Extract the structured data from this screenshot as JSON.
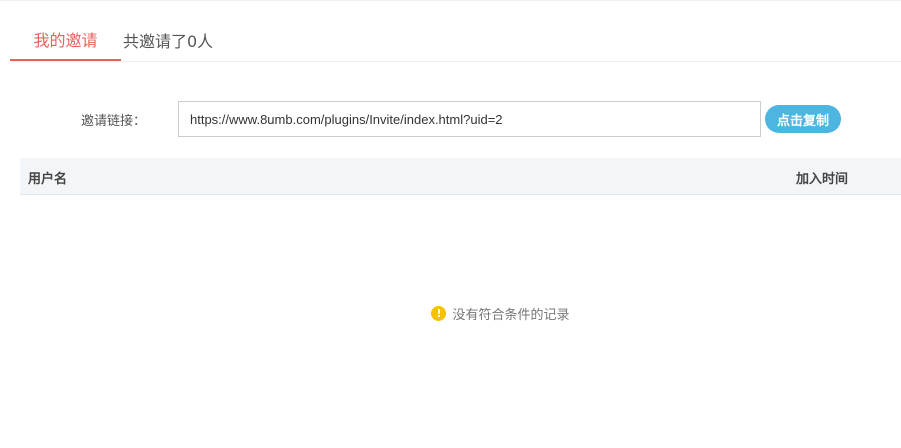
{
  "tabs": [
    {
      "label": "我的邀请",
      "active": true
    },
    {
      "label": "共邀请了0人",
      "active": false
    }
  ],
  "invite": {
    "label": "邀请链接：",
    "url": "https://www.8umb.com/plugins/Invite/index.html?uid=2",
    "copy_label": "点击复制"
  },
  "table": {
    "columns": [
      "用户名",
      "加入时间"
    ],
    "rows": [],
    "empty_text": "没有符合条件的记录",
    "empty_icon": "warning-icon"
  },
  "colors": {
    "accent": "#e8625b",
    "button": "#4db6e0",
    "warning": "#f6c100"
  }
}
